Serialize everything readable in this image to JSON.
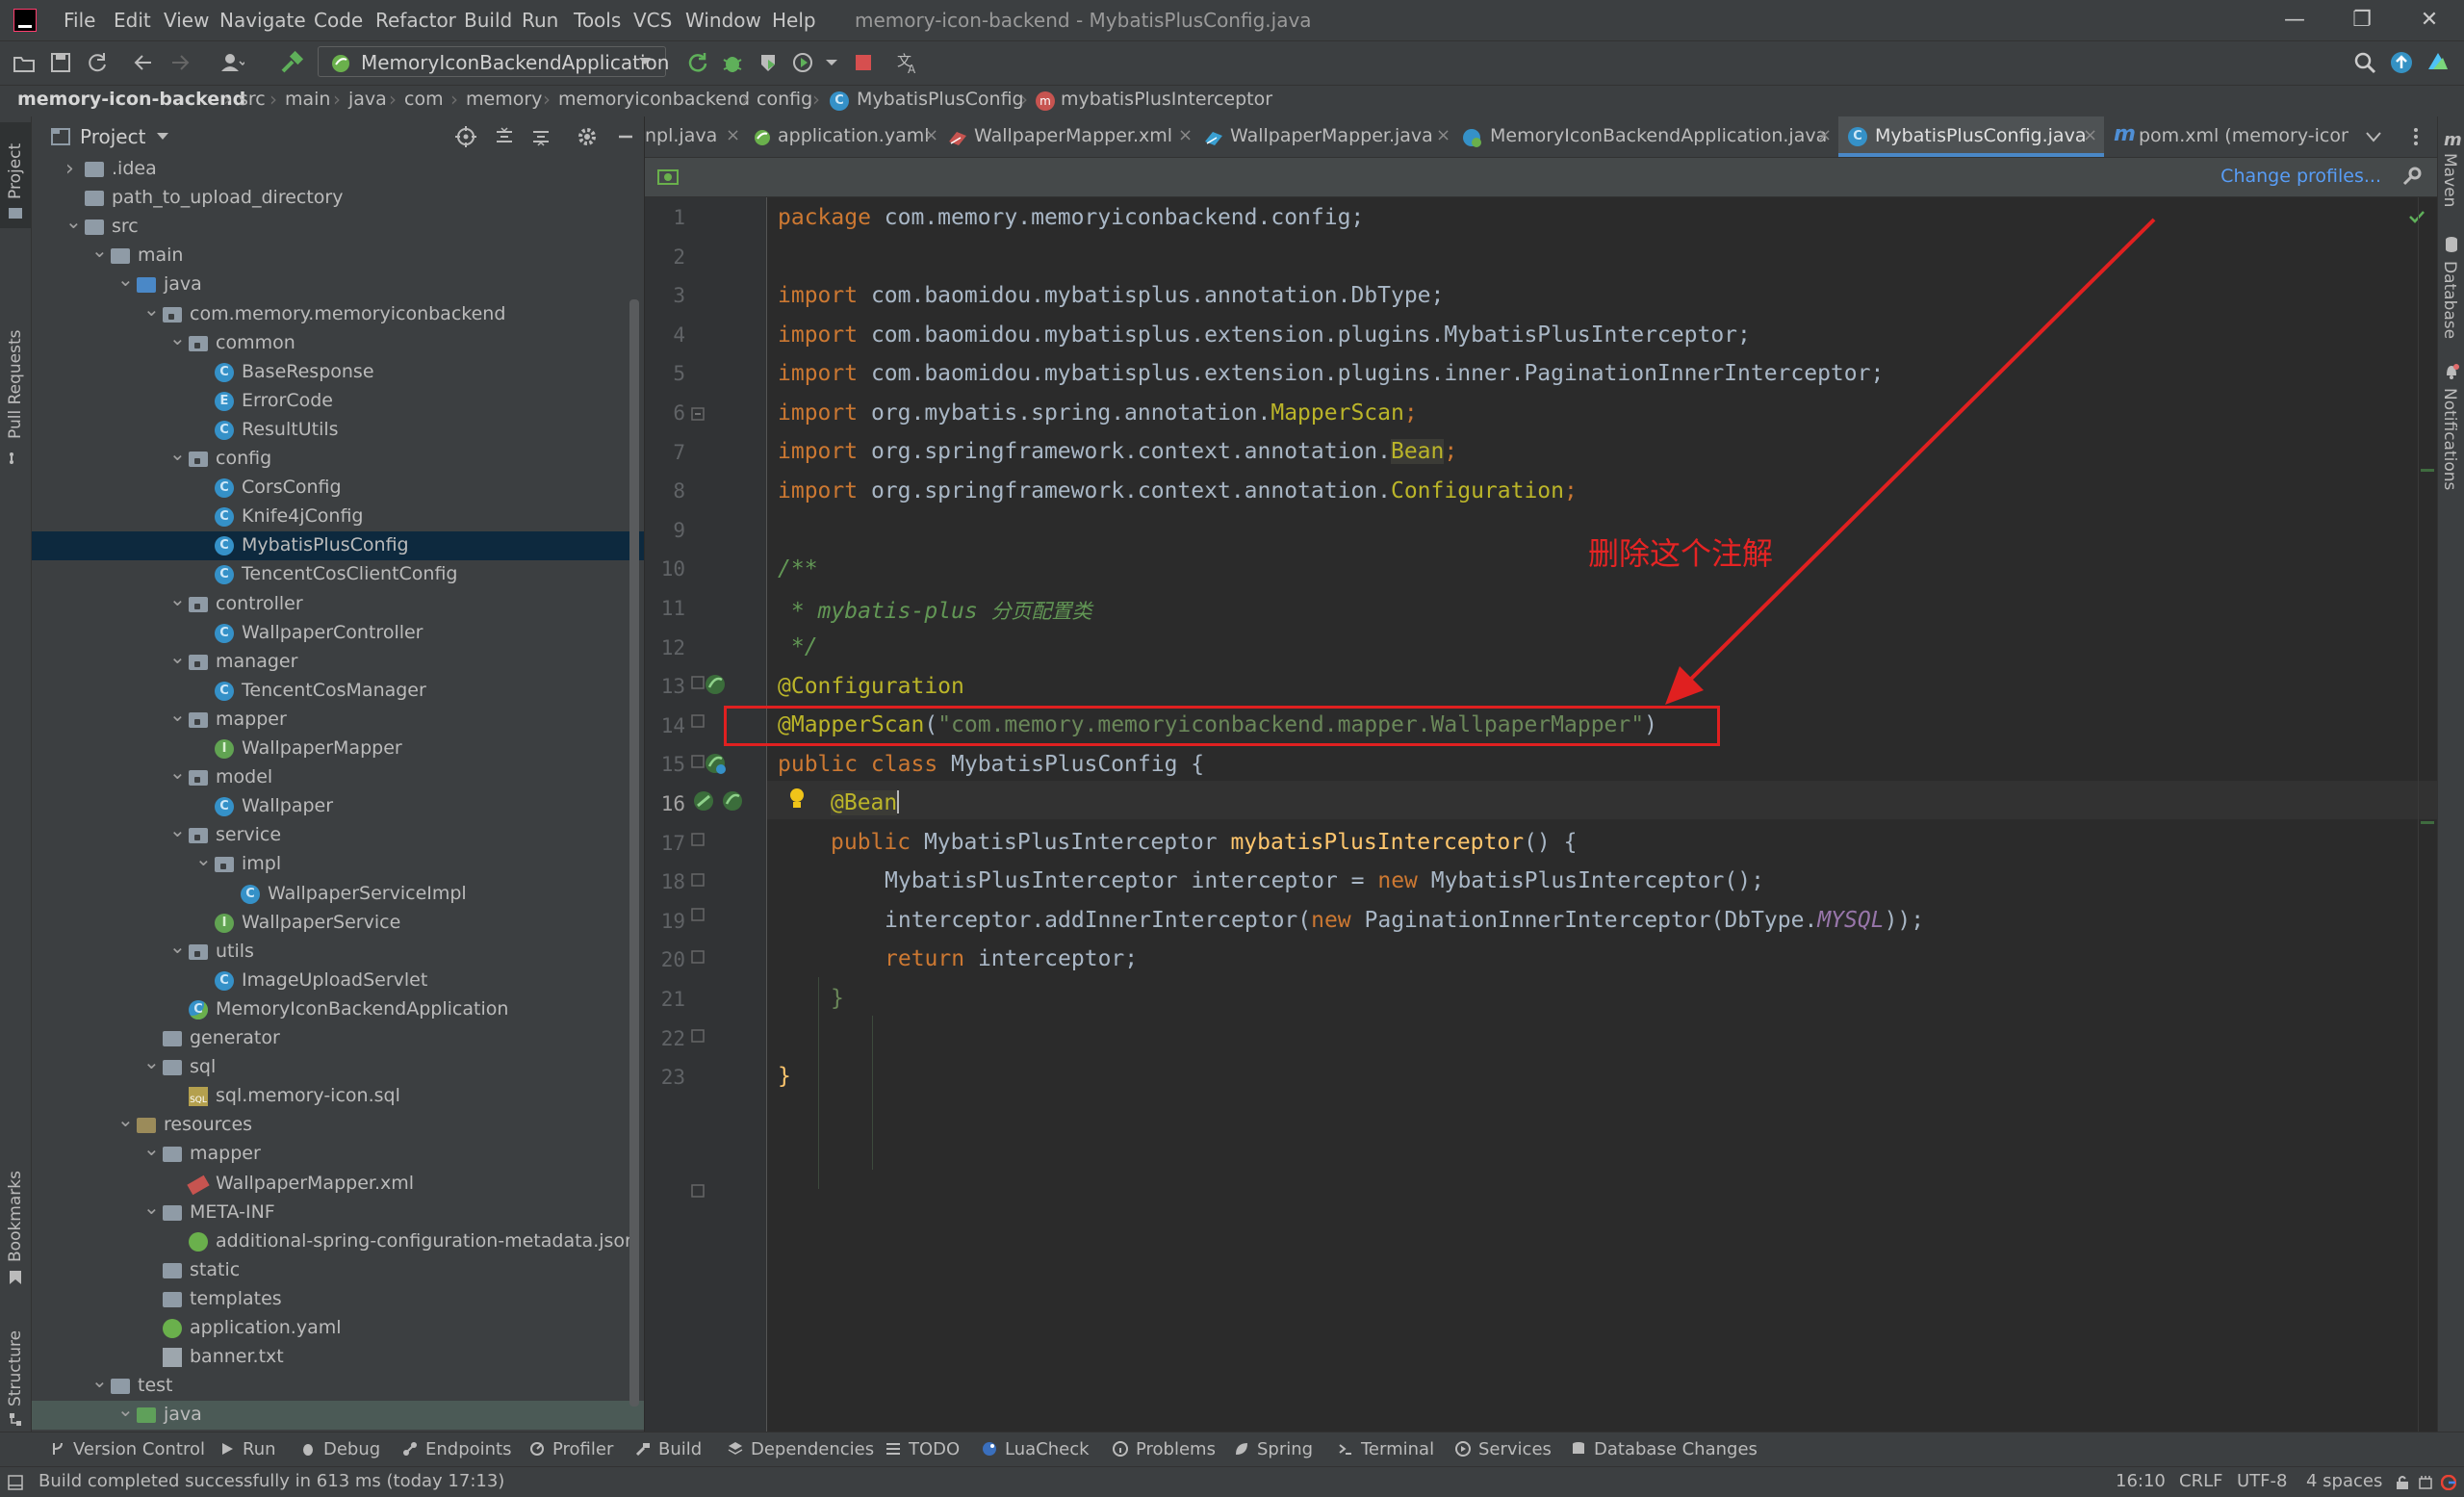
{
  "window": {
    "title": "memory-icon-backend - MybatisPlusConfig.java",
    "menu": [
      "File",
      "Edit",
      "View",
      "Navigate",
      "Code",
      "Refactor",
      "Build",
      "Run",
      "Tools",
      "VCS",
      "Window",
      "Help"
    ]
  },
  "toolbar": {
    "run_config": "MemoryIconBackendApplication"
  },
  "breadcrumb": [
    "memory-icon-backend",
    "src",
    "main",
    "java",
    "com",
    "memory",
    "memoryiconbackend",
    "config",
    "MybatisPlusConfig",
    "mybatisPlusInterceptor"
  ],
  "left_stripe": {
    "project": "Project",
    "pull_requests": "Pull Requests",
    "bookmarks": "Bookmarks",
    "structure": "Structure"
  },
  "right_stripe": {
    "maven": "Maven",
    "database": "Database",
    "notifications": "Notifications"
  },
  "project_panel": {
    "title": "Project"
  },
  "tree": [
    {
      "label": ".idea",
      "depth": 1,
      "icon": "folder",
      "expanded": false
    },
    {
      "label": "path_to_upload_directory",
      "depth": 1,
      "icon": "folder",
      "leaf": true
    },
    {
      "label": "src",
      "depth": 1,
      "icon": "folder",
      "expanded": true
    },
    {
      "label": "main",
      "depth": 2,
      "icon": "folder",
      "expanded": true
    },
    {
      "label": "java",
      "depth": 3,
      "icon": "source-folder",
      "expanded": true
    },
    {
      "label": "com.memory.memoryiconbackend",
      "depth": 4,
      "icon": "package",
      "expanded": true
    },
    {
      "label": "common",
      "depth": 5,
      "icon": "package",
      "expanded": true
    },
    {
      "label": "BaseResponse",
      "depth": 6,
      "icon": "class",
      "leaf": true
    },
    {
      "label": "ErrorCode",
      "depth": 6,
      "icon": "enum",
      "leaf": true
    },
    {
      "label": "ResultUtils",
      "depth": 6,
      "icon": "class",
      "leaf": true
    },
    {
      "label": "config",
      "depth": 5,
      "icon": "package",
      "expanded": true
    },
    {
      "label": "CorsConfig",
      "depth": 6,
      "icon": "class",
      "leaf": true
    },
    {
      "label": "Knife4jConfig",
      "depth": 6,
      "icon": "class",
      "leaf": true
    },
    {
      "label": "MybatisPlusConfig",
      "depth": 6,
      "icon": "class",
      "leaf": true,
      "selected": true
    },
    {
      "label": "TencentCosClientConfig",
      "depth": 6,
      "icon": "class",
      "leaf": true
    },
    {
      "label": "controller",
      "depth": 5,
      "icon": "package",
      "expanded": true
    },
    {
      "label": "WallpaperController",
      "depth": 6,
      "icon": "class",
      "leaf": true
    },
    {
      "label": "manager",
      "depth": 5,
      "icon": "package",
      "expanded": true
    },
    {
      "label": "TencentCosManager",
      "depth": 6,
      "icon": "class",
      "leaf": true
    },
    {
      "label": "mapper",
      "depth": 5,
      "icon": "package",
      "expanded": true
    },
    {
      "label": "WallpaperMapper",
      "depth": 6,
      "icon": "interface",
      "leaf": true
    },
    {
      "label": "model",
      "depth": 5,
      "icon": "package",
      "expanded": true
    },
    {
      "label": "Wallpaper",
      "depth": 6,
      "icon": "class",
      "leaf": true
    },
    {
      "label": "service",
      "depth": 5,
      "icon": "package",
      "expanded": true
    },
    {
      "label": "impl",
      "depth": 6,
      "icon": "package",
      "expanded": true
    },
    {
      "label": "WallpaperServiceImpl",
      "depth": 7,
      "icon": "class",
      "leaf": true
    },
    {
      "label": "WallpaperService",
      "depth": 6,
      "icon": "interface",
      "leaf": true
    },
    {
      "label": "utils",
      "depth": 5,
      "icon": "package",
      "expanded": true
    },
    {
      "label": "ImageUploadServlet",
      "depth": 6,
      "icon": "class",
      "leaf": true
    },
    {
      "label": "MemoryIconBackendApplication",
      "depth": 5,
      "icon": "spring-class",
      "leaf": true
    },
    {
      "label": "generator",
      "depth": 4,
      "icon": "folder",
      "leaf": true
    },
    {
      "label": "sql",
      "depth": 4,
      "icon": "folder",
      "expanded": true
    },
    {
      "label": "sql.memory-icon.sql",
      "depth": 5,
      "icon": "sql-file",
      "leaf": true
    },
    {
      "label": "resources",
      "depth": 3,
      "icon": "resources-folder",
      "expanded": true
    },
    {
      "label": "mapper",
      "depth": 4,
      "icon": "folder",
      "expanded": true
    },
    {
      "label": "WallpaperMapper.xml",
      "depth": 5,
      "icon": "xml-file",
      "leaf": true
    },
    {
      "label": "META-INF",
      "depth": 4,
      "icon": "folder",
      "expanded": true
    },
    {
      "label": "additional-spring-configuration-metadata.json",
      "depth": 5,
      "icon": "json-file",
      "leaf": true
    },
    {
      "label": "static",
      "depth": 4,
      "icon": "folder",
      "leaf": true
    },
    {
      "label": "templates",
      "depth": 4,
      "icon": "folder",
      "leaf": true
    },
    {
      "label": "application.yaml",
      "depth": 4,
      "icon": "yaml-file",
      "leaf": true
    },
    {
      "label": "banner.txt",
      "depth": 4,
      "icon": "text-file",
      "leaf": true
    },
    {
      "label": "test",
      "depth": 2,
      "icon": "folder",
      "expanded": true
    },
    {
      "label": "java",
      "depth": 3,
      "icon": "test-folder",
      "expanded": true,
      "dimselected": true
    }
  ],
  "tabs": [
    {
      "label": "npl.java",
      "icon": "none"
    },
    {
      "label": "application.yaml",
      "icon": "yaml"
    },
    {
      "label": "WallpaperMapper.xml",
      "icon": "xml"
    },
    {
      "label": "WallpaperMapper.java",
      "icon": "interface"
    },
    {
      "label": "MemoryIconBackendApplication.java",
      "icon": "spring"
    },
    {
      "label": "MybatisPlusConfig.java",
      "icon": "class",
      "active": true
    },
    {
      "label": "pom.xml (memory-icon",
      "icon": "maven"
    }
  ],
  "notification": {
    "change_profiles": "Change profiles..."
  },
  "line_numbers": [
    "1",
    "2",
    "3",
    "4",
    "5",
    "6",
    "7",
    "8",
    "9",
    "10",
    "11",
    "12",
    "13",
    "14",
    "15",
    "16",
    "17",
    "18",
    "19",
    "20",
    "21",
    "22",
    "23"
  ],
  "code": {
    "l1_kw": "package",
    "l1_rest": " com.memory.memoryiconbackend.config;",
    "import_kw": "import",
    "l3": " com.baomidou.mybatisplus.annotation.DbType;",
    "l4": " com.baomidou.mybatisplus.extension.plugins.MybatisPlusInterceptor;",
    "l5": " com.baomidou.mybatisplus.extension.plugins.inner.PaginationInnerInterceptor;",
    "l6_pre": " org.mybatis.spring.annotation.",
    "l6_ann": "MapperScan",
    "l7_pre": " org.springframework.context.annotation.",
    "l7_ann": "Bean",
    "l8_pre": " org.springframework.context.annotation.",
    "l8_ann": "Configuration",
    "semicolon": ";",
    "l10": "/**",
    "l11_a": " * mybatis-plus ",
    "l11_b": "分页配置类",
    "l12": " */",
    "l13": "@Configuration",
    "l14_ann": "@MapperScan",
    "l14_open": "(",
    "l14_str": "\"com.memory.memoryiconbackend.mapper.WallpaperMapper\"",
    "l14_close": ")",
    "l15_kw": "public class",
    "l15_rest": " MybatisPlusConfig {",
    "l16": "@Bean",
    "l17_kw": "public",
    "l17_type": " MybatisPlusInterceptor ",
    "l17_fn": "mybatisPlusInterceptor",
    "l17_rest": "() {",
    "l18_a": "MybatisPlusInterceptor interceptor = ",
    "l18_kw": "new",
    "l18_b": " MybatisPlusInterceptor();",
    "l19_a": "interceptor.addInnerInterceptor(",
    "l19_kw": "new",
    "l19_b": " PaginationInnerInterceptor(DbType.",
    "l19_const": "MYSQL",
    "l19_c": "));",
    "l20_kw": "return",
    "l20_rest": " interceptor;",
    "l21": "}",
    "l23": "}"
  },
  "annotation": {
    "text": "删除这个注解",
    "color": "#e02020"
  },
  "bottom_tools": [
    "Version Control",
    "Run",
    "Debug",
    "Endpoints",
    "Profiler",
    "Build",
    "Dependencies",
    "TODO",
    "LuaCheck",
    "Problems",
    "Spring",
    "Terminal",
    "Services",
    "Database Changes"
  ],
  "status": {
    "message": "Build completed successfully in 613 ms (today 17:13)",
    "position": "16:10",
    "line_sep": "CRLF",
    "encoding": "UTF-8",
    "indent": "4 spaces"
  },
  "colors": {
    "accent": "#4a88c7",
    "selection": "#0d293e",
    "keyword": "#cc7832",
    "string": "#6a8759",
    "annotation": "#bbb529"
  }
}
